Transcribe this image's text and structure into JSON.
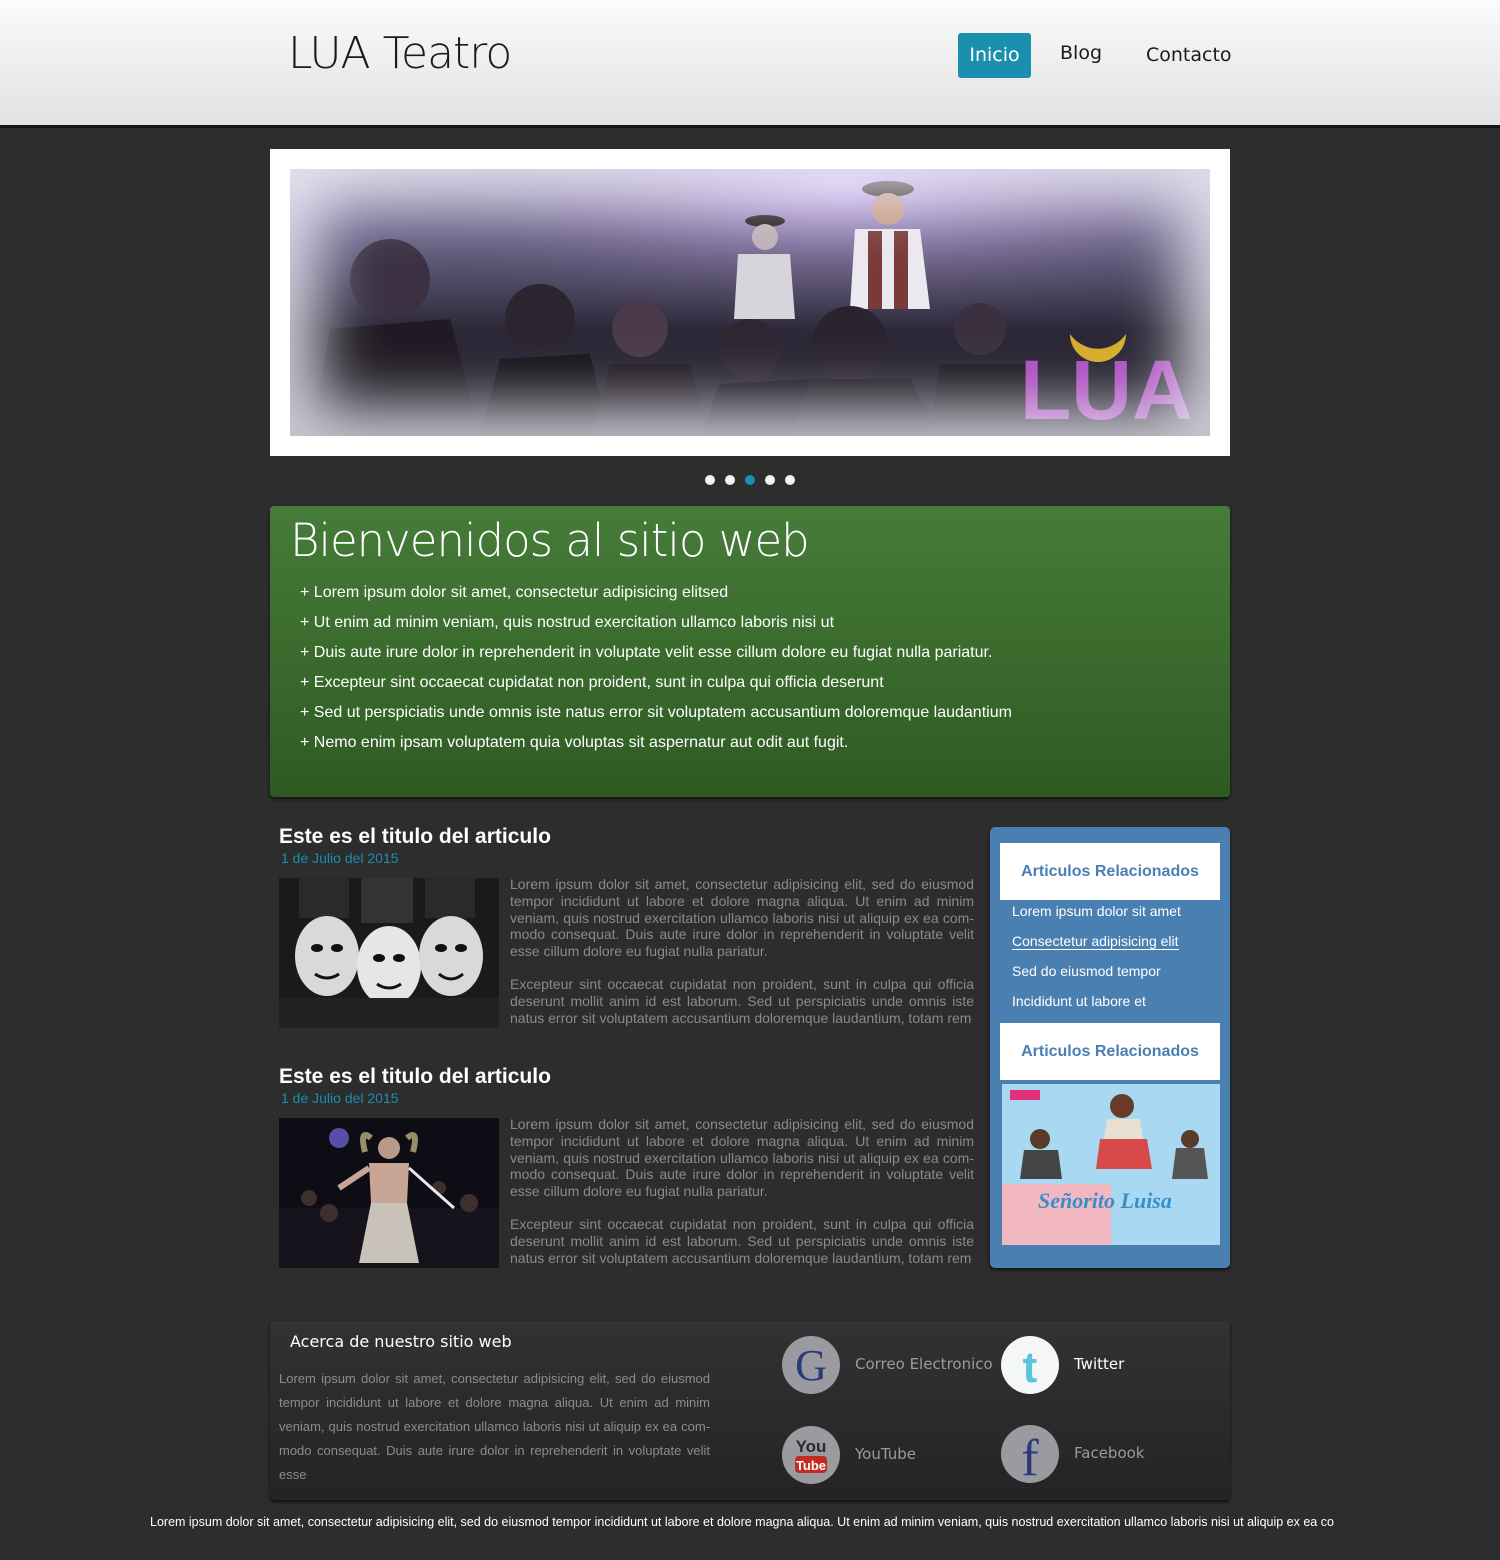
{
  "header": {
    "logo": "LUA Teatro",
    "nav": [
      {
        "label": "Inicio",
        "active": true
      },
      {
        "label": "Blog"
      },
      {
        "label": "Contacto"
      }
    ]
  },
  "slider": {
    "image_alt": "Teatro escena",
    "image_logo_text": "LUA",
    "dots": 5,
    "active_dot": 3
  },
  "welcome": {
    "title": "Bienvenidos al sitio web",
    "items": [
      "+ Lorem ipsum dolor sit amet, consectetur adipisicing elitsed",
      "+ Ut enim ad minim veniam, quis nostrud exercitation ullamco laboris nisi ut",
      "+ Duis aute irure dolor in reprehenderit in voluptate velit esse cillum dolore eu fugiat nulla pariatur.",
      "+ Excepteur sint occaecat cupidatat non proident, sunt in culpa qui officia deserunt",
      "+ Sed ut perspiciatis unde omnis iste natus error sit voluptatem accusantium doloremque laudantium",
      "+ Nemo enim ipsam voluptatem quia voluptas sit aspernatur aut odit aut fugit."
    ]
  },
  "articles": [
    {
      "title": "Este es el titulo del articulo",
      "date": "1 de Julio del 2015",
      "p1": "Lorem ipsum dolor sit amet, consectetur adipisicing elit, sed do eiusmod tempor incididunt ut labore et dolore magna aliqua. Ut enim ad minim veniam, quis nostrud exercitation ullamco laboris nisi ut aliquip ex ea com-modo consequat. Duis aute irure dolor in reprehenderit in voluptate velit esse cillum dolore eu fugiat nulla pariatur.",
      "p2": "Excepteur sint occaecat cupidatat non proident, sunt in culpa qui officia deserunt mollit anim id est laborum. Sed ut perspiciatis unde omnis iste natus error sit voluptatem accusantium doloremque laudantium, totam rem"
    },
    {
      "title": "Este es el titulo del articulo",
      "date": "1 de Julio del 2015",
      "p1": "Lorem ipsum dolor sit amet, consectetur adipisicing elit, sed do eiusmod tempor incididunt ut labore et dolore magna aliqua. Ut enim ad minim veniam, quis nostrud exercitation ullamco laboris nisi ut aliquip ex ea com-modo consequat. Duis aute irure dolor in reprehenderit in voluptate velit esse cillum dolore eu fugiat nulla pariatur.",
      "p2": "Excepteur sint occaecat cupidatat non proident, sunt in culpa qui officia deserunt mollit anim id est laborum. Sed ut perspiciatis unde omnis iste natus error sit voluptatem accusantium doloremque laudantium, totam rem"
    }
  ],
  "sidebar": {
    "heading1": "Articulos Relacionados",
    "links": [
      "Lorem ipsum dolor sit amet",
      "Consectetur adipisicing elit",
      "Sed do eiusmod tempor",
      "Incididunt ut labore et"
    ],
    "heading2": "Articulos Relacionados",
    "poster_text": "Señorito Luisa"
  },
  "footer": {
    "about_title": "Acerca de nuestro sitio web",
    "about_text": "Lorem ipsum dolor sit amet, consectetur adipisicing elit, sed do eiusmod tempor incididunt ut labore et dolore magna aliqua. Ut enim ad minim veniam, quis nostrud exercitation ullamco laboris nisi ut aliquip ex ea com-modo consequat. Duis aute irure dolor in reprehenderit in voluptate velit esse",
    "social": {
      "email": "Correo Electronico",
      "twitter": "Twitter",
      "youtube": "YouTube",
      "facebook": "Facebook"
    },
    "bottom_text": "Lorem ipsum dolor sit amet, consectetur adipisicing elit, sed do eiusmod tempor incididunt ut labore et dolore magna aliqua. Ut enim ad minim veniam, quis nostrud exercitation ullamco laboris nisi ut aliquip ex ea co"
  },
  "colors": {
    "accent": "#1a8fae",
    "welcome_green": "#3e6e31",
    "sidebar_blue": "#4a7fb1",
    "background": "#2d2d2d"
  },
  "icons": {
    "email": "google-g-icon",
    "twitter": "twitter-icon",
    "youtube": "youtube-icon",
    "facebook": "facebook-icon"
  }
}
